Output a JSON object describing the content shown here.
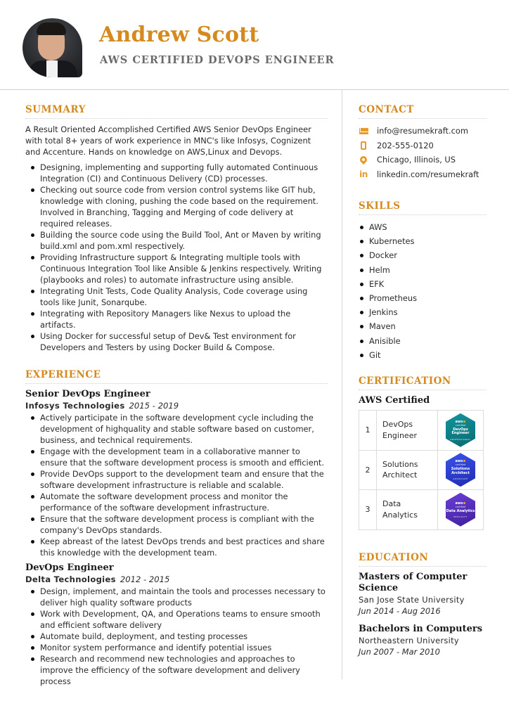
{
  "header": {
    "name": "Andrew Scott",
    "title": "AWS CERTIFIED DEVOPS ENGINEER",
    "accent_color": "#d58a1e"
  },
  "summary": {
    "heading": "SUMMARY",
    "paragraph": "A Result Oriented Accomplished Certified AWS Senior DevOps Engineer with total 8+ years of work experience in MNC's like Infosys, Cognizent and Accenture. Hands on knowledge on AWS,Linux and Devops.",
    "bullets": [
      "Designing, implementing and supporting fully automated Continuous Integration (CI) and Continuous Delivery (CD) processes.",
      "Checking out source code from version control systems like GIT hub, knowledge with cloning, pushing the code based on the requirement. Involved in Branching, Tagging and Merging of code delivery at required releases.",
      "Building the source code using the Build Tool, Ant or Maven by writing build.xml and pom.xml respectively.",
      "Providing Infrastructure support & Integrating multiple tools with Continuous Integration Tool like Ansible & Jenkins respectively. Writing (playbooks and roles) to automate infrastructure using ansible.",
      "Integrating Unit Tests, Code Quality Analysis, Code coverage using tools like Junit, Sonarqube.",
      "Integrating with Repository Managers like Nexus to upload the artifacts.",
      "Using Docker for successful setup of Dev& Test environment for Developers and Testers by using Docker Build & Compose."
    ]
  },
  "experience": {
    "heading": "EXPERIENCE",
    "jobs": [
      {
        "title": "Senior DevOps Engineer",
        "company": "Infosys Technologies",
        "dates": "2015 - 2019",
        "bullets": [
          "Actively participate in the software development cycle including the development of highquality and stable software based on customer, business, and technical requirements.",
          "Engage with the development team in a collaborative manner to ensure that the software development process is smooth and efficient.",
          "Provide DevOps support to the development team and ensure that the software development infrastructure is reliable and scalable.",
          "Automate the software development process and monitor the performance of the software development infrastructure.",
          "Ensure that the software development process is compliant with the company's DevOps standards.",
          "Keep abreast of the latest DevOps trends and best practices and share this knowledge with the development team."
        ]
      },
      {
        "title": "DevOps Engineer",
        "company": "Delta Technologies",
        "dates": "2012 - 2015",
        "bullets": [
          "Design, implement, and maintain the tools and processes necessary to deliver high quality software products",
          "Work with Development, QA, and Operations teams to ensure smooth and efficient software delivery",
          "Automate build, deployment, and testing processes",
          "Monitor system performance and identify potential issues",
          "Research and recommend new technologies and approaches to improve the efficiency of the software development and delivery process"
        ]
      }
    ]
  },
  "contact": {
    "heading": "CONTACT",
    "items": [
      {
        "icon": "mail-icon",
        "text": "info@resumekraft.com"
      },
      {
        "icon": "phone-icon",
        "text": "202-555-0120"
      },
      {
        "icon": "location-pin-icon",
        "text": "Chicago, Illinois, US"
      },
      {
        "icon": "linkedin-icon",
        "text": "linkedin.com/resumekraft",
        "glyph": "in"
      }
    ]
  },
  "skills": {
    "heading": "SKILLS",
    "items": [
      "AWS",
      "Kubernetes",
      "Docker",
      "Helm",
      "EFK",
      "Prometheus",
      "Jenkins",
      "Maven",
      "Anisible",
      "Git"
    ]
  },
  "certification": {
    "heading": "CERTIFICATION",
    "subheading": "AWS Certified",
    "rows": [
      {
        "num": "1",
        "label": "DevOps Engineer",
        "badge": {
          "brand": "aws",
          "word": "certified",
          "name": "DevOps Engineer",
          "level": "PROFESSIONAL",
          "color": "#0f7e86"
        }
      },
      {
        "num": "2",
        "label": "Solutions Architect",
        "badge": {
          "brand": "aws",
          "word": "certified",
          "name": "Solutions Architect",
          "level": "ASSOCIATE",
          "color": "#2d3fd1"
        }
      },
      {
        "num": "3",
        "label": "Data Analytics",
        "badge": {
          "brand": "aws",
          "word": "certified",
          "name": "Data Analytics",
          "level": "SPECIALTY",
          "color": "#5a2fc0"
        }
      }
    ]
  },
  "education": {
    "heading": "EDUCATION",
    "items": [
      {
        "degree": "Masters of Computer Science",
        "school": "San Jose State University",
        "dates": "Jun 2014 - Aug 2016"
      },
      {
        "degree": "Bachelors in Computers",
        "school": "Northeastern University",
        "dates": "Jun 2007 - Mar 2010"
      }
    ]
  }
}
